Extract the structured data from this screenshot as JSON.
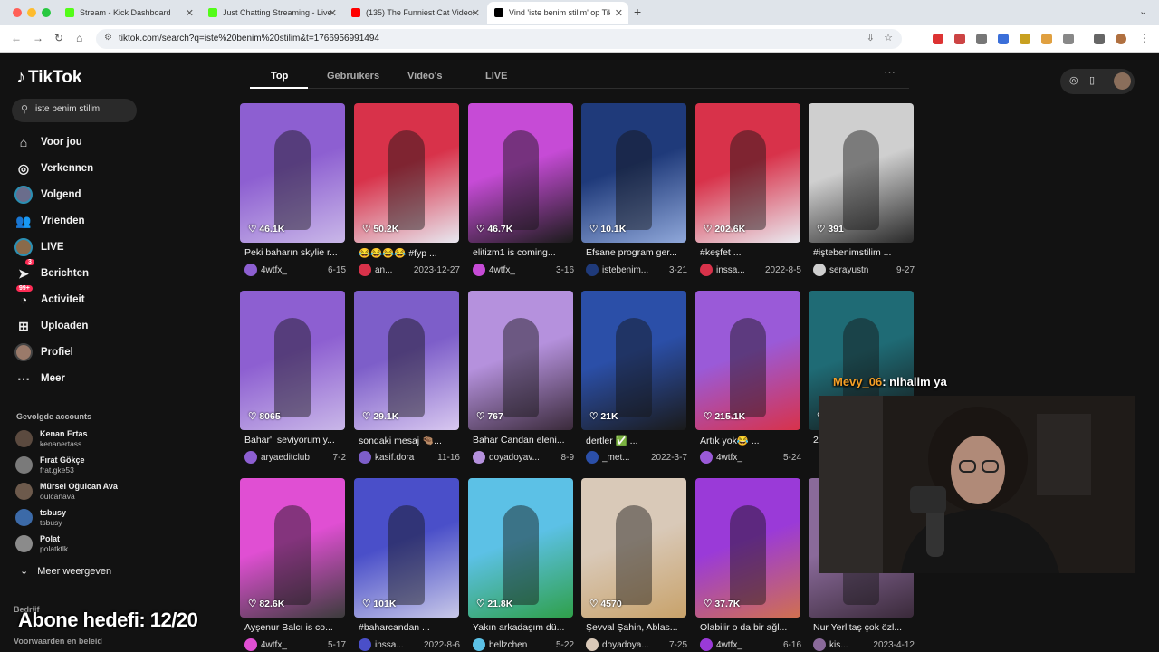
{
  "browser": {
    "tabs": [
      {
        "title": "Stream - Kick Dashboard",
        "favicon_color": "#53fc18"
      },
      {
        "title": "Just Chatting Streaming - Live",
        "favicon_color": "#53fc18"
      },
      {
        "title": "(135) The Funniest Cat Videos",
        "favicon_color": "#ff0000"
      },
      {
        "title": "Vind 'iste benim stilim' op TikTok",
        "favicon_color": "#000000"
      }
    ],
    "url": "tiktok.com/search?q=iste%20benim%20stilim&t=1766956991494"
  },
  "sidebar": {
    "logo": "TikTok",
    "search_value": "iste benim stilim",
    "nav": [
      {
        "label": "Voor jou",
        "icon": "home-icon"
      },
      {
        "label": "Verkennen",
        "icon": "compass-icon"
      },
      {
        "label": "Volgend",
        "icon": "avatar-icon"
      },
      {
        "label": "Vrienden",
        "icon": "friends-icon"
      },
      {
        "label": "LIVE",
        "icon": "live-icon"
      },
      {
        "label": "Berichten",
        "icon": "message-icon",
        "badge": "3"
      },
      {
        "label": "Activiteit",
        "icon": "activity-icon",
        "badge": "99+"
      },
      {
        "label": "Uploaden",
        "icon": "upload-icon"
      },
      {
        "label": "Profiel",
        "icon": "profile-icon"
      },
      {
        "label": "Meer",
        "icon": "more-icon"
      }
    ],
    "following_title": "Gevolgde accounts",
    "following": [
      {
        "name": "Kenan Ertas",
        "handle": "kenanertass",
        "color": "#5b4a3f"
      },
      {
        "name": "Fırat Gökçe",
        "handle": "frat.gke53",
        "color": "#7a7a7a"
      },
      {
        "name": "Mürsel Oğulcan Ava",
        "handle": "oulcanava",
        "color": "#6d5a4c"
      },
      {
        "name": "tsbusy",
        "handle": "tsbusy",
        "color": "#3c6aa8"
      },
      {
        "name": "Polat",
        "handle": "polatktlk",
        "color": "#8b8b8b"
      }
    ],
    "show_more": "Meer weergeven",
    "footer_company": "Bedrijf",
    "footer_terms": "Voorwaarden en beleid"
  },
  "overlay": {
    "goal": "Abone hedefi: 12/20",
    "chat_user": "Mevy_06",
    "chat_text": ": nihalim ya"
  },
  "search_tabs": [
    "Top",
    "Gebruikers",
    "Video's",
    "LIVE"
  ],
  "videos": [
    {
      "views": "46.1K",
      "desc": "Peki baharın skylie r...",
      "user": "4wtfx_",
      "date": "6-15",
      "c1": "#8d5fd1",
      "c2": "#c9b7e8"
    },
    {
      "views": "50.2K",
      "desc": "😂😂😂😂 #fyp ...",
      "user": "an...",
      "date": "2023-12-27",
      "c1": "#d8324a",
      "c2": "#e8e8f0"
    },
    {
      "views": "46.7K",
      "desc": "elitizm1 is coming...",
      "user": "4wtfx_",
      "date": "3-16",
      "c1": "#c64bd6",
      "c2": "#1b1b1b"
    },
    {
      "views": "10.1K",
      "desc": "Efsane program ger...",
      "user": "istebenim...",
      "date": "3-21",
      "c1": "#1f3a7a",
      "c2": "#8fa7d9"
    },
    {
      "views": "202.6K",
      "desc": "#keşfet ...",
      "user": "inssa...",
      "date": "2022-8-5",
      "c1": "#d8324a",
      "c2": "#eaeaf0"
    },
    {
      "views": "391",
      "desc": "#iştebenimstilim ...",
      "user": "serayustn",
      "date": "9-27",
      "c1": "#cfcfcf",
      "c2": "#2a2a2a"
    },
    {
      "views": "8065",
      "desc": "Bahar'ı seviyorum y...",
      "user": "aryaeditclub",
      "date": "7-2",
      "c1": "#8d5fd1",
      "c2": "#c9b7e8"
    },
    {
      "views": "29.1K",
      "desc": "sondaki mesaj 🤏🏽...",
      "user": "kasif.dora",
      "date": "11-16",
      "c1": "#7d5ec9",
      "c2": "#d8c8f0"
    },
    {
      "views": "767",
      "desc": "Bahar Candan eleni...",
      "user": "doyadoyav...",
      "date": "8-9",
      "c1": "#b591dd",
      "c2": "#3a2a3a"
    },
    {
      "views": "21K",
      "desc": "dertler ✅ ...",
      "user": "_met...",
      "date": "2022-3-7",
      "c1": "#2b4fa8",
      "c2": "#1a1a1a"
    },
    {
      "views": "215.1K",
      "desc": "Artık yok😂 ...",
      "user": "4wtfx_",
      "date": "5-24",
      "c1": "#9a5ad8",
      "c2": "#d8324a"
    },
    {
      "views": "47.2K",
      "desc": "2025 güncellemesi",
      "user": "",
      "date": "",
      "c1": "#1f6b75",
      "c2": "#141414"
    },
    {
      "views": "82.6K",
      "desc": "Ayşenur Balcı is co...",
      "user": "4wtfx_",
      "date": "5-17",
      "c1": "#e04fd3",
      "c2": "#3c3c3c"
    },
    {
      "views": "101K",
      "desc": "#baharcandan ...",
      "user": "inssa...",
      "date": "2022-8-6",
      "c1": "#4a4fc9",
      "c2": "#c8c8e8"
    },
    {
      "views": "21.8K",
      "desc": "Yakın arkadaşım dü...",
      "user": "bellzchen",
      "date": "5-22",
      "c1": "#5cc1e6",
      "c2": "#2fa04a"
    },
    {
      "views": "4570",
      "desc": "Şevval Şahin, Ablas...",
      "user": "doyadoya...",
      "date": "7-25",
      "c1": "#d9c9b8",
      "c2": "#c8a26a"
    },
    {
      "views": "37.7K",
      "desc": "Olabilir o da bir ağl...",
      "user": "4wtfx_",
      "date": "6-16",
      "c1": "#9a3ad8",
      "c2": "#d07050"
    },
    {
      "views": "",
      "desc": "Nur Yerlitaş çok özl...",
      "user": "kis...",
      "date": "2023-4-12",
      "c1": "#8a6a9a",
      "c2": "#3a2a3a"
    }
  ]
}
